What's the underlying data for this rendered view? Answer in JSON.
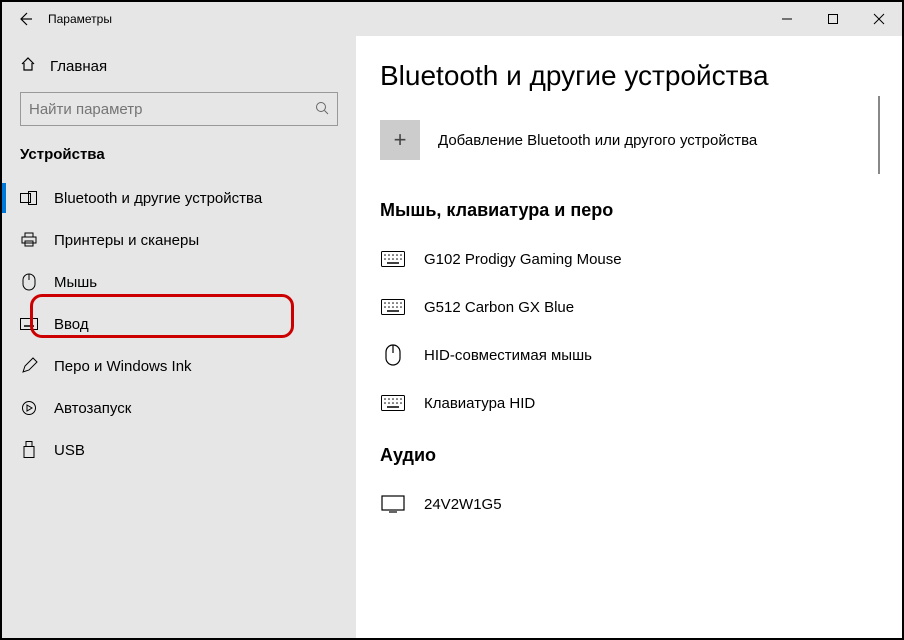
{
  "window": {
    "title": "Параметры"
  },
  "sidebar": {
    "home": "Главная",
    "search_placeholder": "Найти параметр",
    "heading": "Устройства",
    "items": [
      {
        "label": "Bluetooth и другие устройства"
      },
      {
        "label": "Принтеры и сканеры"
      },
      {
        "label": "Мышь"
      },
      {
        "label": "Ввод"
      },
      {
        "label": "Перо и Windows Ink"
      },
      {
        "label": "Автозапуск"
      },
      {
        "label": "USB"
      }
    ]
  },
  "main": {
    "title": "Bluetooth и другие устройства",
    "add_label": "Добавление Bluetooth или другого устройства",
    "sections": [
      {
        "heading": "Мышь, клавиатура и перо",
        "devices": [
          {
            "name": "G102 Prodigy Gaming Mouse",
            "icon": "keyboard"
          },
          {
            "name": "G512 Carbon GX Blue",
            "icon": "keyboard"
          },
          {
            "name": "HID-совместимая мышь",
            "icon": "mouse"
          },
          {
            "name": "Клавиатура HID",
            "icon": "keyboard"
          }
        ]
      },
      {
        "heading": "Аудио",
        "devices": [
          {
            "name": "24V2W1G5",
            "icon": "monitor"
          }
        ]
      }
    ]
  }
}
